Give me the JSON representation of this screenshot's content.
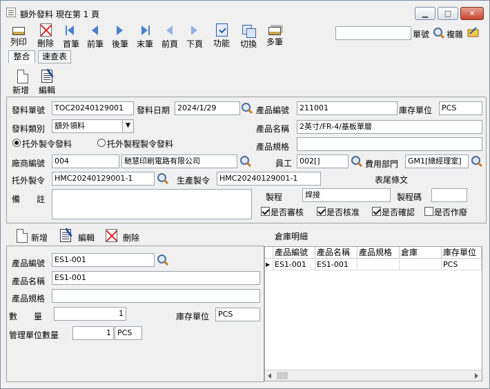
{
  "window": {
    "title": "額外發料  現在第 1 頁",
    "minimize_glyph": "▁",
    "maximize_glyph": "□",
    "close_glyph": "✕"
  },
  "toolbar": {
    "print": "列印",
    "delete": "刪除",
    "first": "首筆",
    "prev": "前筆",
    "next": "後筆",
    "last": "末筆",
    "prev_page": "前頁",
    "next_page": "下頁",
    "function": "功能",
    "switch": "切換",
    "multi": "多筆",
    "search_value": "",
    "order_no_label": "單號",
    "copy_label": "複雜"
  },
  "tabs": [
    "整合",
    "速查表"
  ],
  "header_actions": {
    "add": "新增",
    "edit": "編輯"
  },
  "form": {
    "issue_no_label": "發料單號",
    "issue_no": "TOC20240129001",
    "issue_date_label": "發料日期",
    "issue_date": "2024/1/29",
    "product_code_label": "產品編號",
    "product_code": "211001",
    "stock_unit_label": "庫存單位",
    "stock_unit": "PCS",
    "issue_type_label": "發料類別",
    "issue_type": "額外領料",
    "product_name_label": "產品名稱",
    "product_name": "2英寸/FR-4/基板單層",
    "product_spec_label": "產品規格",
    "product_spec": "",
    "radio_outsource_order": "托外製令發料",
    "radio_outsource_process": "托外製程製令發料",
    "vendor_code_label": "廠商編號",
    "vendor_code": "004",
    "vendor_name": "馳慧印刷電路有限公司",
    "staff_label": "員工",
    "staff": "002[]",
    "cost_dept_label": "費用部門",
    "cost_dept": "GM1[總經理室]",
    "outsource_order_label": "托外製令",
    "outsource_order": "HMC20240129001-1",
    "production_order_label": "生產製令",
    "production_order": "HMC20240129001-1",
    "tail_clause_label": "表尾條文",
    "remark_label": "備　　註",
    "remark": "",
    "process_label": "製程",
    "process": "焊接",
    "process_code_label": "製程碼",
    "process_code": "",
    "chk_reviewed": "是否審核",
    "chk_approved": "是否核准",
    "chk_confirmed": "是否確認",
    "chk_voided": "是否作廢"
  },
  "detail_actions": {
    "add": "新增",
    "edit": "編輯",
    "delete": "刪除"
  },
  "detail": {
    "product_code_label": "產品編號",
    "product_code": "ES1-001",
    "product_name_label": "產品名稱",
    "product_name": "ES1-001",
    "product_spec_label": "產品規格",
    "product_spec": "",
    "qty_label": "數　　量",
    "qty": "1",
    "stock_unit_label": "庫存單位",
    "stock_unit": "PCS",
    "mgmt_qty_label": "管理單位數量",
    "mgmt_qty": "1",
    "mgmt_unit": "PCS"
  },
  "warehouse": {
    "title": "倉庫明細",
    "columns": [
      "產品編號",
      "產品名稱",
      "產品規格",
      "倉庫",
      "庫存單位"
    ],
    "rows": [
      [
        "ES1-001",
        "ES1-001",
        "",
        "",
        "PCS"
      ]
    ],
    "row_pointer": "▶"
  }
}
